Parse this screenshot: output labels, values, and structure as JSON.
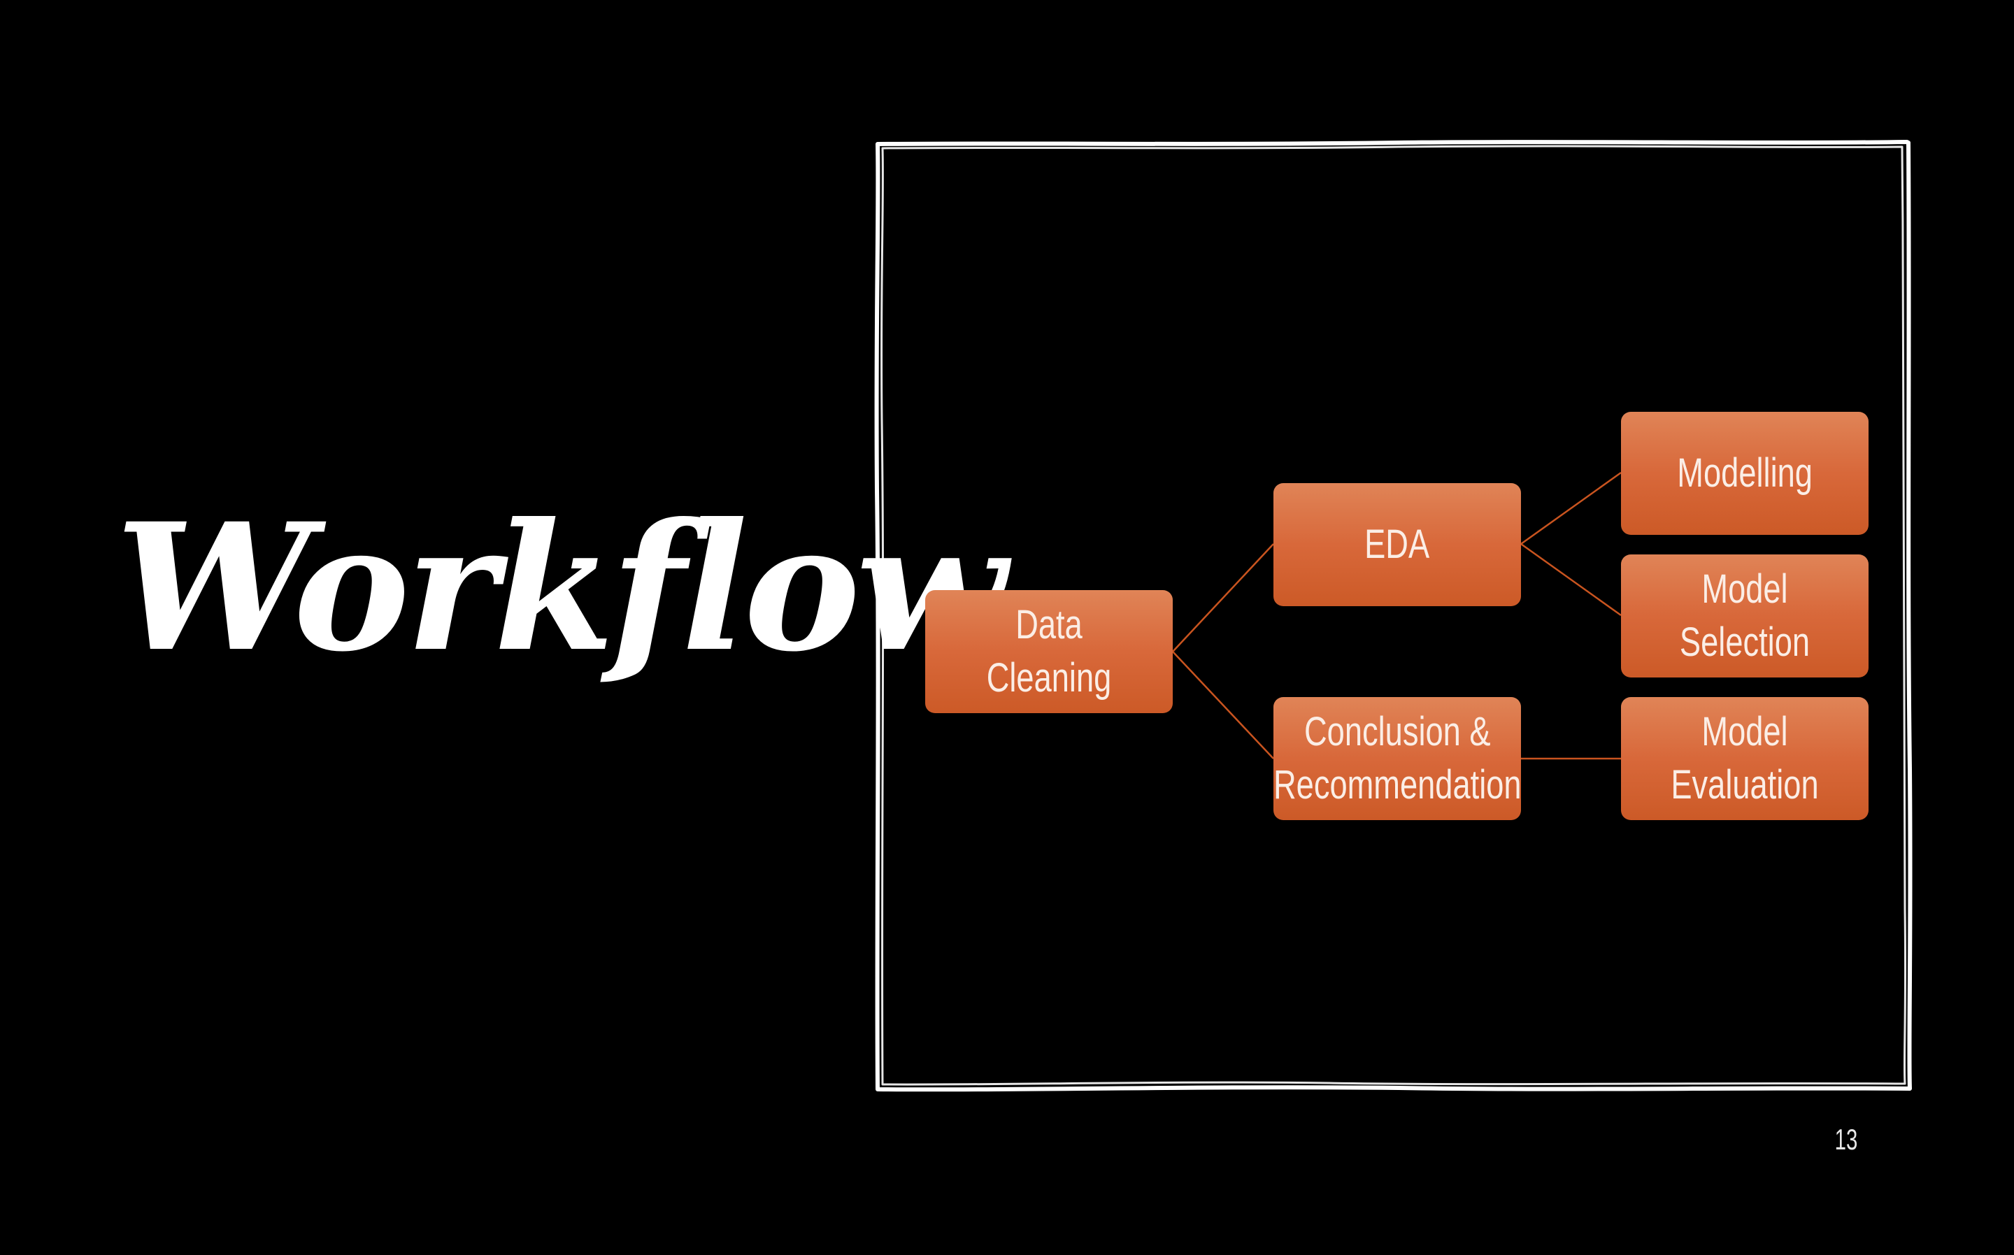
{
  "slide": {
    "title": "Workflow",
    "page_number": "13"
  },
  "diagram": {
    "connector_color": "#c9541f",
    "node_color": "#d8683a",
    "nodes": {
      "data_cleaning": "Data Cleaning",
      "eda": "EDA",
      "conclusion": "Conclusion &\nRecommendation",
      "modelling": "Modelling",
      "model_selection": "Model Selection",
      "model_evaluation": "Model Evaluation"
    }
  }
}
